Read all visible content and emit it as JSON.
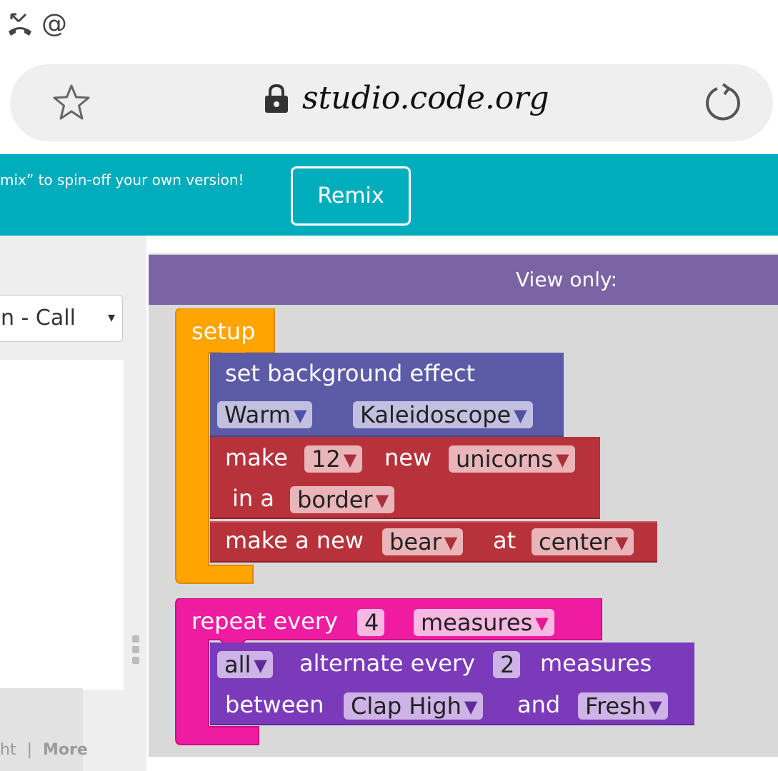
{
  "status_bar": {
    "call_icon": "missed-call-icon",
    "at_icon": "@"
  },
  "browser": {
    "url": "studio.code.org",
    "icons": [
      "star-icon",
      "lock-icon",
      "reload-icon"
    ]
  },
  "banner": {
    "text": "mix” to spin-off your own version!",
    "remix_label": "Remix"
  },
  "left_panel": {
    "dropdown_value": "n - Call",
    "dropdown_arrow": "▾",
    "footer_left": "ht",
    "footer_sep": "|",
    "footer_more": "More"
  },
  "workspace": {
    "header_label": "View only:",
    "blocks": {
      "setup": {
        "label": "setup"
      },
      "background": {
        "label": "set background effect",
        "palette": "Warm",
        "effect": "Kaleidoscope"
      },
      "make_group": {
        "label_make": "make",
        "count": "12",
        "label_new": "new",
        "sprite": "unicorns",
        "label_in_a": "in a",
        "layout": "border"
      },
      "make_new": {
        "label": "make a new",
        "sprite": "bear",
        "label_at": "at",
        "location": "center"
      },
      "repeat": {
        "label": "repeat every",
        "count": "4",
        "unit": "measures"
      },
      "alternate": {
        "target": "all",
        "label_alternate": "alternate every",
        "count": "2",
        "label_measures": "measures",
        "label_between": "between",
        "dance_a": "Clap High",
        "label_and": "and",
        "dance_b": "Fresh"
      }
    },
    "colors": {
      "setup": "#ffa400",
      "background": "#5b5ba8",
      "make": "#b7323b",
      "repeat": "#ef1ca1",
      "alternate": "#7b3aba"
    }
  }
}
